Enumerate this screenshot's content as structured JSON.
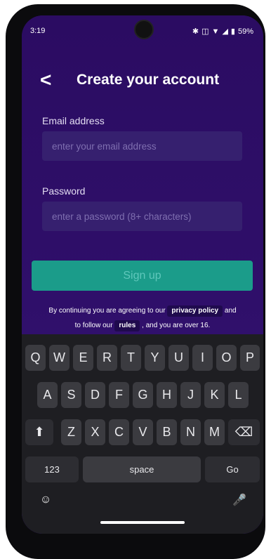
{
  "status": {
    "time": "3:19",
    "battery": "59%"
  },
  "header": {
    "back_label": "<",
    "title": "Create your account"
  },
  "form": {
    "email_label": "Email address",
    "email_placeholder": "enter your email address",
    "password_label": "Password",
    "password_placeholder": "enter a password (8+ characters)",
    "signup_label": "Sign up"
  },
  "legal": {
    "line1_prefix": "By continuing you are agreeing to our",
    "privacy_label": "privacy policy",
    "line1_suffix": "and",
    "line2_prefix": "to follow our",
    "rules_label": "rules",
    "line2_suffix": ", and you are over 16."
  },
  "keyboard": {
    "row1": [
      "Q",
      "W",
      "E",
      "R",
      "T",
      "Y",
      "U",
      "I",
      "O",
      "P"
    ],
    "row2": [
      "A",
      "S",
      "D",
      "F",
      "G",
      "H",
      "J",
      "K",
      "L"
    ],
    "row3": [
      "Z",
      "X",
      "C",
      "V",
      "B",
      "N",
      "M"
    ],
    "bottom": {
      "numbers_label": "123",
      "space_label": "space",
      "go_label": "Go"
    }
  },
  "colors": {
    "background": "#2c0f67",
    "field": "#36206f",
    "signup": "#1b9c8a"
  }
}
